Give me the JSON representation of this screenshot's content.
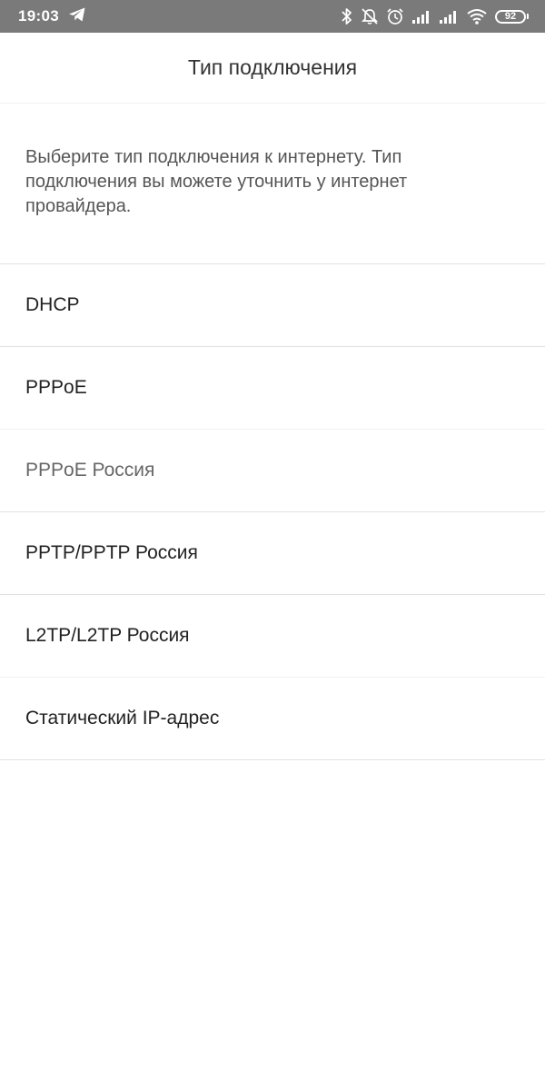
{
  "status_bar": {
    "time": "19:03",
    "battery_level": "92",
    "icons": [
      "telegram-icon",
      "bluetooth-icon",
      "bell-off-icon",
      "alarm-icon",
      "signal-icon",
      "signal-icon",
      "wifi-icon",
      "battery-icon"
    ]
  },
  "header": {
    "title": "Тип подключения"
  },
  "description": "Выберите тип подключения к интернету. Тип подключения вы можете уточнить у интернет провайдера.",
  "connection_types": [
    {
      "label": "DHCP"
    },
    {
      "label": "PPPoE"
    },
    {
      "label": "PPPoE Россия"
    },
    {
      "label": "PPTP/PPTP Россия"
    },
    {
      "label": "L2TP/L2TP Россия"
    },
    {
      "label": "Статический IP-адрес"
    }
  ],
  "colors": {
    "status_bar_bg": "#7a7a7a",
    "background": "#ffffff",
    "text_primary": "#222222",
    "text_secondary": "#555555",
    "divider": "#e2e2e2"
  }
}
